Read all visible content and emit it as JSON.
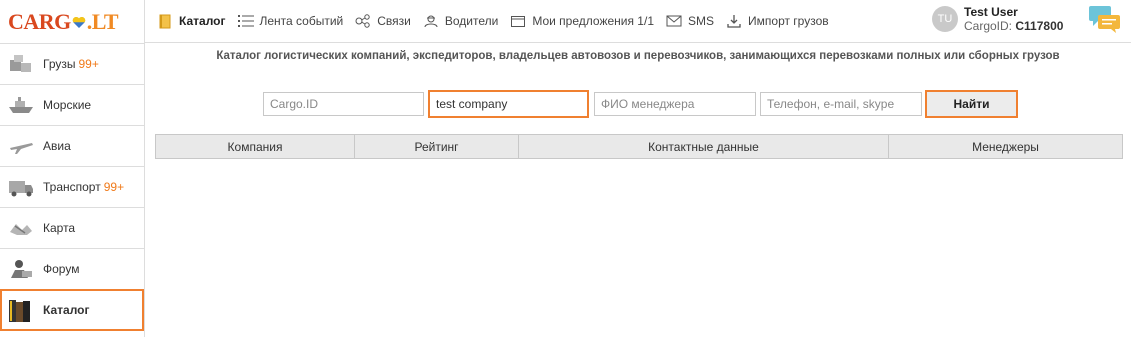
{
  "logo": {
    "part1": "CARG",
    "part2": ".LT"
  },
  "sidebar": {
    "items": [
      {
        "label": "Грузы",
        "badge": "99+",
        "icon": "cargo-boxes-icon"
      },
      {
        "label": "Морские",
        "badge": "",
        "icon": "ship-icon"
      },
      {
        "label": "Авиа",
        "badge": "",
        "icon": "plane-icon"
      },
      {
        "label": "Транспорт",
        "badge": "99+",
        "icon": "truck-icon"
      },
      {
        "label": "Карта",
        "badge": "",
        "icon": "map-icon"
      },
      {
        "label": "Форум",
        "badge": "",
        "icon": "forum-icon"
      },
      {
        "label": "Каталог",
        "badge": "",
        "icon": "catalog-books-icon"
      }
    ]
  },
  "topnav": {
    "items": [
      {
        "label": "Каталог",
        "icon": "book-icon"
      },
      {
        "label": "Лента событий",
        "icon": "list-icon"
      },
      {
        "label": "Связи",
        "icon": "connections-icon"
      },
      {
        "label": "Водители",
        "icon": "drivers-icon"
      },
      {
        "label": "Мои предложения 1/1",
        "icon": "folder-icon"
      },
      {
        "label": "SMS",
        "icon": "envelope-icon"
      },
      {
        "label": "Импорт грузов",
        "icon": "download-icon"
      }
    ]
  },
  "user": {
    "initials": "TU",
    "name": "Test User",
    "id_label": "CargoID:",
    "id_value": "C117800"
  },
  "main": {
    "headline": "Каталог логистических компаний, экспедиторов, владельцев автовозов и перевозчиков, занимающихся перевозками полных или сборных грузов",
    "search": {
      "cargo_id_placeholder": "Cargo.ID",
      "company_value": "test company",
      "manager_placeholder": "ФИО менеджера",
      "contact_placeholder": "Телефон, e-mail, skype",
      "button_label": "Найти"
    },
    "table": {
      "columns": [
        "Компания",
        "Рейтинг",
        "Контактные данные",
        "Менеджеры"
      ]
    }
  },
  "colors": {
    "accent": "#f08030",
    "logo_red": "#d9481f",
    "badge": "#f07a1a"
  }
}
